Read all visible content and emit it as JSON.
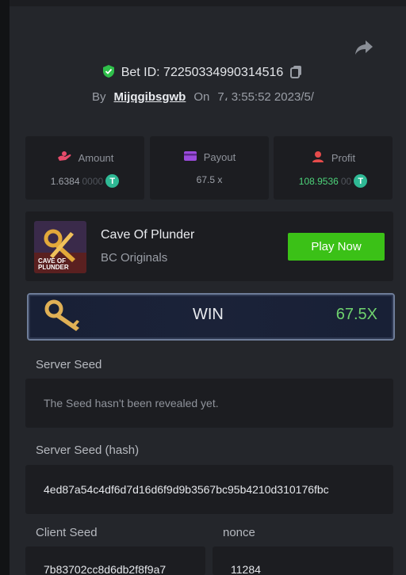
{
  "bet": {
    "bet_id": "Bet ID: 72250334990314516",
    "by_label": "By",
    "username": "Mijqgibsgwb",
    "on_label": "On",
    "datetime": "7، 3:55:52 2023/5/"
  },
  "stats": {
    "amount": {
      "label": "Amount",
      "value_main": "1.6384",
      "value_dim": "0000"
    },
    "payout": {
      "label": "Payout",
      "value": "67.5 x"
    },
    "profit": {
      "label": "Profit",
      "value_main": "108.9536",
      "value_dim": "00"
    },
    "coin_symbol": "T"
  },
  "game": {
    "name": "Cave Of Plunder",
    "provider": "BC Originals",
    "play_label": "Play Now",
    "thumb_text_1": "CAVE OF",
    "thumb_text_2": "PLUNDER"
  },
  "result": {
    "label": "WIN",
    "multiplier": "67.5X"
  },
  "seeds": {
    "server_seed_label": "Server Seed",
    "server_seed_value": "The Seed hasn't been revealed yet.",
    "server_hash_label": "Server Seed (hash)",
    "server_hash_value": "4ed87a54c4df6d7d16d6f9d9b3567bc95b4210d310176fbc",
    "client_seed_label": "Client Seed",
    "client_seed_value": "7b83702cc8d6db2f8f9a7",
    "nonce_label": "nonce",
    "nonce_value": "11284"
  },
  "colors": {
    "accent_green": "#3bc117",
    "profit_green": "#4dd37a",
    "coin": "#2fb995",
    "panel": "#1c1d21",
    "background": "#24262b"
  },
  "icons": [
    "share-icon",
    "shield-check-icon",
    "copy-icon",
    "amount-icon",
    "payout-icon",
    "profit-icon",
    "tether-coin-icon",
    "game-thumbnail",
    "key-icon"
  ]
}
